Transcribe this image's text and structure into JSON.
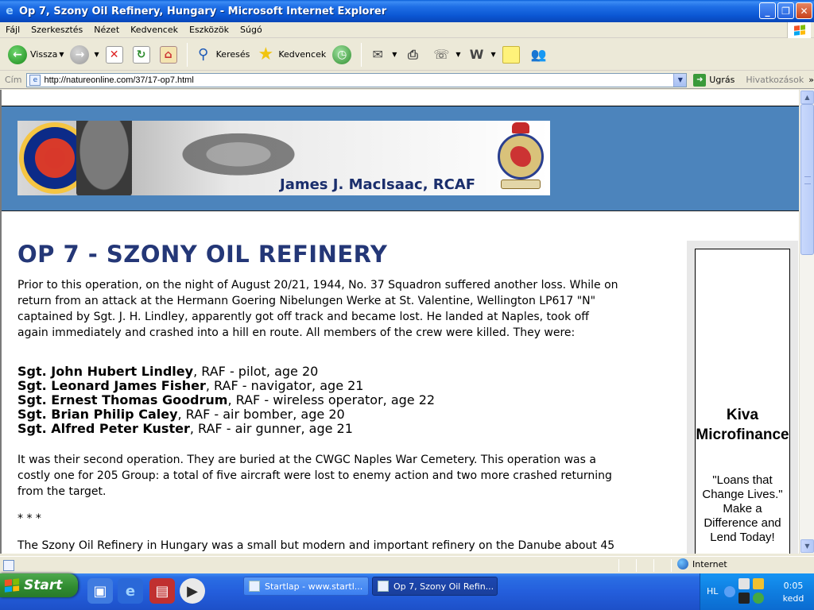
{
  "window": {
    "title": "Op 7, Szony Oil Refinery, Hungary - Microsoft Internet Explorer",
    "minimize": "_",
    "restore": "❐",
    "close": "✕"
  },
  "menu": {
    "items": [
      "Fájl",
      "Szerkesztés",
      "Nézet",
      "Kedvencek",
      "Eszközök",
      "Súgó"
    ]
  },
  "toolbar": {
    "back_label": "Vissza",
    "search_label": "Keresés",
    "favorites_label": "Kedvencek"
  },
  "address": {
    "label": "Cím",
    "url": "http://natureonline.com/37/17-op7.html",
    "go_label": "Ugrás",
    "links_label": "Hivatkozások"
  },
  "page": {
    "banner_name": "James J. MacIsaac, RCAF",
    "title": "OP 7 - SZONY OIL REFINERY",
    "intro": "Prior to this operation, on the night of August 20/21, 1944, No. 37 Squadron suffered another loss. While on return from an attack at the Hermann Goering Nibelungen Werke at St. Valentine, Wellington LP617 \"N\" captained by Sgt. J. H. Lindley, apparently got off track and became lost. He landed at Naples, took off again immediately and crashed into a hill en route. All members of the crew were killed. They were:",
    "crew": [
      {
        "name": "Sgt. John Hubert Lindley",
        "detail": ", RAF - pilot, age 20"
      },
      {
        "name": "Sgt. Leonard James Fisher",
        "detail": ", RAF - navigator, age 21"
      },
      {
        "name": "Sgt. Ernest Thomas Goodrum",
        "detail": ", RAF - wireless operator, age 22"
      },
      {
        "name": "Sgt. Brian Philip Caley",
        "detail": ", RAF - air bomber, age 20"
      },
      {
        "name": "Sgt. Alfred Peter Kuster",
        "detail": ", RAF - air gunner, age 21"
      }
    ],
    "second_para": "It was their second operation. They are buried at the CWGC Naples War Cemetery. This operation was a costly one for 205 Group: a total of five aircraft were lost to enemy action and two more crashed returning from the target.",
    "separator": "* * *",
    "cut_para": "The Szony Oil Refinery in Hungary was a small but modern and important refinery on the Danube about 45"
  },
  "ad": {
    "title": "Kiva\nMicrofinance",
    "text": "\"Loans that\nChange Lives.\"\nMake a\nDifference and\nLend Today!"
  },
  "status": {
    "zone": "Internet"
  },
  "taskbar": {
    "start_label": "Start",
    "tasks": [
      {
        "label": "Startlap - www.startl...",
        "active": false
      },
      {
        "label": "Op 7, Szony Oil Refin...",
        "active": true
      }
    ],
    "lang": "HL",
    "time": "0:05",
    "day": "kedd"
  },
  "icons": {
    "ie": "internet-explorer-icon",
    "back": "back-arrow-icon",
    "forward": "forward-arrow-icon",
    "stop": "stop-icon",
    "refresh": "refresh-icon",
    "home": "home-icon",
    "search": "search-icon",
    "favorites": "star-icon",
    "history": "history-icon"
  }
}
